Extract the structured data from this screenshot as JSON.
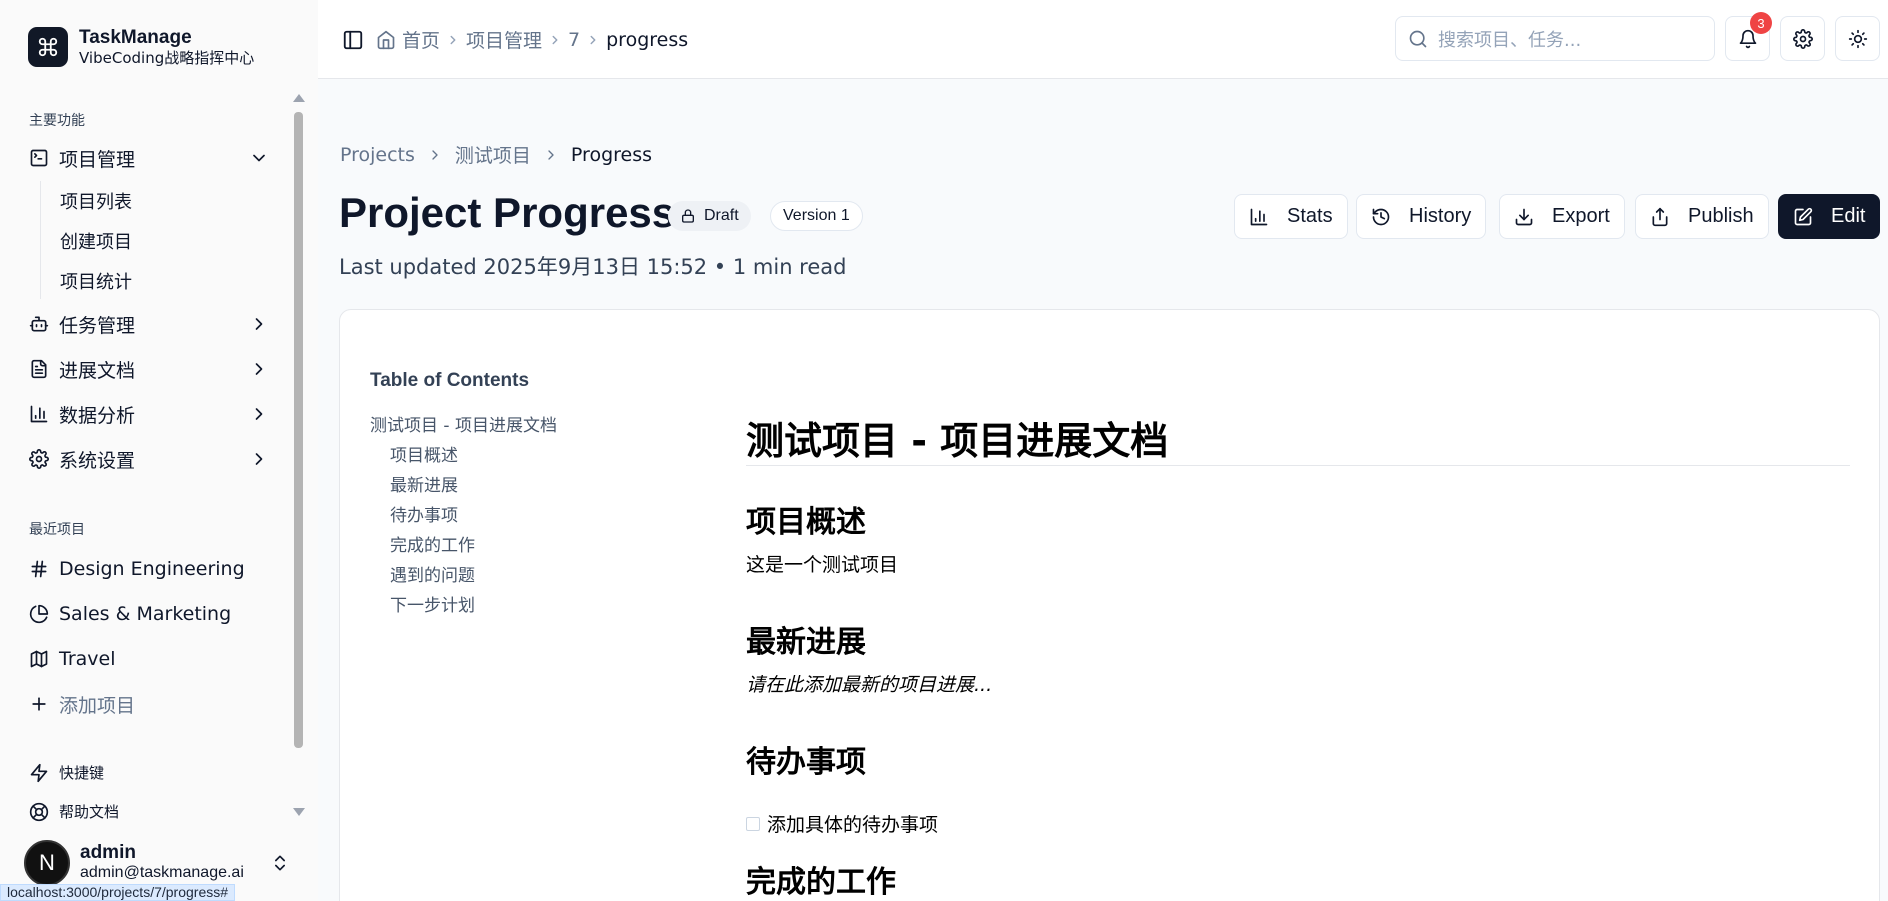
{
  "brand": {
    "name": "TaskManage",
    "subtitle": "VibeCoding战略指挥中心"
  },
  "sidebar": {
    "section_main": "主要功能",
    "nav": [
      {
        "label": "项目管理",
        "icon": "terminal-icon",
        "expanded": true
      },
      {
        "label": "任务管理",
        "icon": "bot-icon",
        "expanded": false
      },
      {
        "label": "进展文档",
        "icon": "file-text-icon",
        "expanded": false
      },
      {
        "label": "数据分析",
        "icon": "bar-chart-icon",
        "expanded": false
      },
      {
        "label": "系统设置",
        "icon": "gear-icon",
        "expanded": false
      }
    ],
    "sub_items": [
      "项目列表",
      "创建项目",
      "项目统计"
    ],
    "section_recent": "最近项目",
    "recent": [
      {
        "label": "Design Engineering",
        "icon": "hash-icon"
      },
      {
        "label": "Sales & Marketing",
        "icon": "pie-chart-icon"
      },
      {
        "label": "Travel",
        "icon": "map-icon"
      }
    ],
    "add_project": "添加项目",
    "shortcuts": "快捷键",
    "help": "帮助文档",
    "user": {
      "initial": "N",
      "name": "admin",
      "email": "admin@taskmanage.ai"
    }
  },
  "status_url": "localhost:3000/projects/7/progress#",
  "topbar": {
    "crumbs": [
      "首页",
      "项目管理",
      "7",
      "progress"
    ],
    "search_placeholder": "搜索项目、任务...",
    "notification_count": "3"
  },
  "page": {
    "crumbs": [
      "Projects",
      "测试项目",
      "Progress"
    ],
    "title": "Project Progress",
    "status": "Draft",
    "version": "Version 1",
    "updated": "Last updated 2025年9月13日 15:52 • 1 min read",
    "actions": {
      "stats": "Stats",
      "history": "History",
      "export": "Export",
      "publish": "Publish",
      "edit": "Edit"
    }
  },
  "toc": {
    "title": "Table of Contents",
    "root": "测试项目 - 项目进展文档",
    "items": [
      "项目概述",
      "最新进展",
      "待办事项",
      "完成的工作",
      "遇到的问题",
      "下一步计划"
    ]
  },
  "doc": {
    "h1": "测试项目 - 项目进展文档",
    "overview_h": "项目概述",
    "overview_p": "这是一个测试项目",
    "progress_h": "最新进展",
    "progress_p": "请在此添加最新的项目进展...",
    "todo_h": "待办事项",
    "todo_item": "添加具体的待办事项",
    "done_h": "完成的工作"
  }
}
